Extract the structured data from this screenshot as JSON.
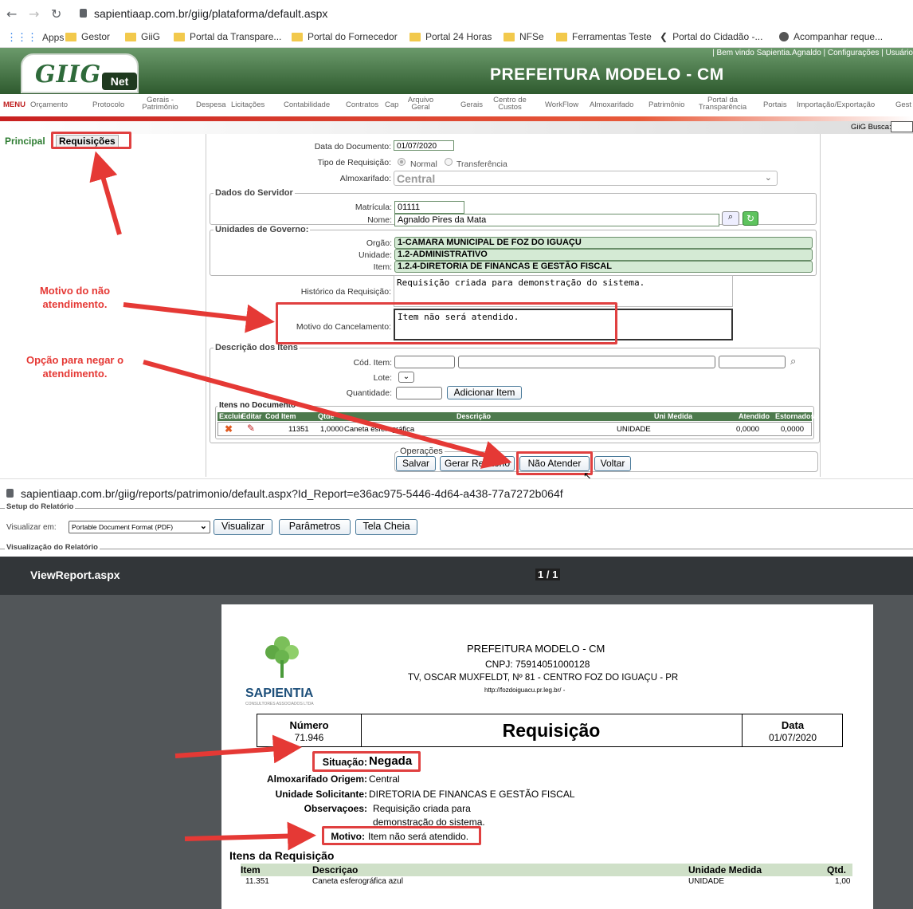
{
  "browser1": {
    "url": "sapientiaap.com.br/giig/plataforma/default.aspx",
    "bookmarks": [
      "Apps",
      "Gestor",
      "GiiG",
      "Portal da Transpare...",
      "Portal do Fornecedor",
      "Portal 24 Horas",
      "NFSe",
      "Ferramentas Teste",
      "Portal do Cidadão -...",
      "Acompanhar reque..."
    ]
  },
  "header": {
    "welcome": "| Bem vindo Sapientia.Agnaldo | Configurações | Usuário",
    "logo_text": "GIIG",
    "logo_sub": "Net",
    "title": "PREFEITURA MODELO - CM",
    "busca_label": "GiiG Busca:"
  },
  "menu": [
    "MENU",
    "Orçamento",
    "Protocolo",
    "Gerais - Patrimônio",
    "Despesa",
    "Licitações",
    "Contabilidade",
    "Contratos",
    "Cap",
    "Arquivo Geral",
    "Gerais",
    "Centro de Custos",
    "WorkFlow",
    "Almoxarifado",
    "Patrimônio",
    "Portal da Transparência",
    "Portais",
    "Importação/Exportação",
    "Gest"
  ],
  "tabs": {
    "principal": "Principal",
    "requisicoes": "Requisições"
  },
  "form": {
    "data_label": "Data do Documento:",
    "data_value": "01/07/2020",
    "tipo_label": "Tipo de Requisição:",
    "tipo_normal": "Normal",
    "tipo_transf": "Transferência",
    "almox_label": "Almoxarifado:",
    "almox_value": "Central",
    "servidor_legend": "Dados do Servidor",
    "matricula_label": "Matrícula:",
    "matricula_value": "01111",
    "nome_label": "Nome:",
    "nome_value": "Agnaldo Pires da Mata",
    "unidades_legend": "Unidades de Governo:",
    "orgao_label": "Orgão:",
    "orgao_value": "1-CAMARA MUNICIPAL DE FOZ DO IGUAÇU",
    "unidade_label": "Unidade:",
    "unidade_value": "1.2-ADMINISTRATIVO",
    "item_label": "Item:",
    "item_value": "1.2.4-DIRETORIA DE FINANCAS E GESTÃO FISCAL",
    "historico_label": "Histórico da Requisição:",
    "historico_value": "Requisição criada para demonstração do sistema.",
    "motivo_label": "Motivo do Cancelamento:",
    "motivo_value": "Item não será atendido.",
    "itens_legend": "Descrição dos Itens",
    "cod_label": "Cód. Item:",
    "lote_label": "Lote:",
    "qtd_label": "Quantidade:",
    "add_button": "Adicionar Item",
    "doc_legend": "Itens no Documento",
    "table_headers": [
      "Excluir",
      "Editar",
      "Cod Item",
      "Qtde",
      "Descrição",
      "Uni Medida",
      "Atendido",
      "Estornados"
    ],
    "row": {
      "cod": "11351",
      "qtde": "1,0000",
      "desc": "Caneta esferográfica",
      "uni": "UNIDADE",
      "atendido": "0,0000",
      "estornados": "0,0000"
    },
    "ops_legend": "Operações",
    "btn_salvar": "Salvar",
    "btn_relatorio": "Gerar Relatório",
    "btn_nao_atender": "Não Atender",
    "btn_voltar": "Voltar"
  },
  "annotations": {
    "motivo": "Motivo do não atendimento.",
    "negar": "Opção para negar o atendimento."
  },
  "browser2": {
    "url": "sapientiaap.com.br/giig/reports/patrimonio/default.aspx?Id_Report=e36ac975-5446-4d64-a438-77a7272b064f",
    "setup_legend": "Setup do Relatório",
    "visualizar_em": "Visualizar em:",
    "format_value": "Portable Document Format (PDF)",
    "btn_visualizar": "Visualizar",
    "btn_parametros": "Parâmetros",
    "btn_tela_cheia": "Tela Cheia",
    "viz_legend": "Visualização do Relatório",
    "viewer_title": "ViewReport.aspx",
    "page_counter": "1 / 1"
  },
  "report": {
    "org": "PREFEITURA MODELO - CM",
    "cnpj": "CNPJ: 75914051000128",
    "address": "TV, OSCAR MUXFELDT, Nº 81 - CENTRO FOZ DO IGUAÇU - PR",
    "site": "http://fozdoiguacu.pr.leg.br/ -",
    "logo_name": "SAPIENTIA",
    "logo_tag": "CONSULTORES ASSOCIADOS LTDA",
    "numero_label": "Número",
    "numero_value": "71.946",
    "doc_title": "Requisição",
    "data_label": "Data",
    "data_value": "01/07/2020",
    "situacao_label": "Situação:",
    "situacao_value": "Negada",
    "almox_label": "Almoxarifado Origem:",
    "almox_value": "Central",
    "unidade_label": "Unidade Solicitante:",
    "unidade_value": "DIRETORIA DE FINANCAS E GESTÃO FISCAL",
    "obs_label": "Observaçoes:",
    "obs_line1": "Requisição criada para",
    "obs_line2": "demonstração do sistema.",
    "motivo_label": "Motivo:",
    "motivo_value": "Item não será atendido.",
    "itens_title": "Itens da Requisição",
    "headers": [
      "Item",
      "Descriçao",
      "Unidade Medida",
      "Qtd."
    ],
    "row": [
      "11.351",
      "Caneta esferográfica azul",
      "UNIDADE",
      "1,00"
    ]
  }
}
